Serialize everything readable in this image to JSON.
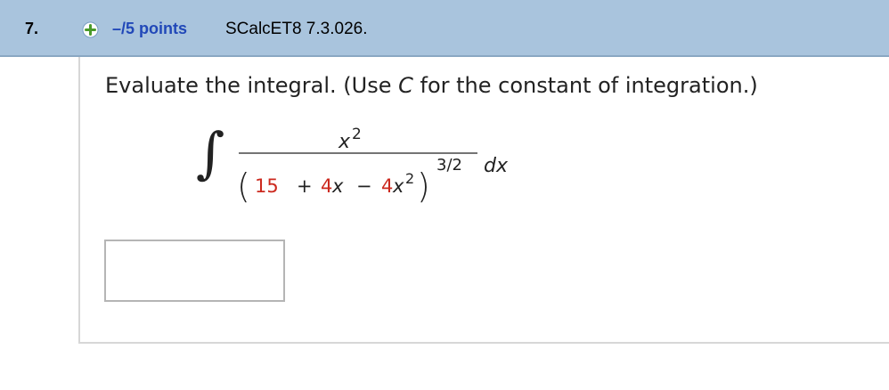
{
  "question": {
    "number": "7.",
    "points": "–/5 points",
    "source": "SCalcET8 7.3.026."
  },
  "instructions": {
    "before": "Evaluate the integral. (Use ",
    "variable": "C",
    "after": " for the constant of integration.)"
  },
  "integral": {
    "symbol": "∫",
    "numerator": "x",
    "numerator_exp": "2",
    "open_paren": "(",
    "close_paren": ")",
    "term1": "15",
    "op1": "+",
    "term2_coef": "4",
    "term2_var": "x",
    "op2": "−",
    "term3_coef": "4",
    "term3_var": "x",
    "term3_exp": "2",
    "outer_exp": "3/2",
    "differential": "dx"
  },
  "colors": {
    "header_bg": "#a9c4dd",
    "points": "#2148b8",
    "coefficient": "#cc2a1f",
    "plus_icon": "#4a9a2a"
  },
  "answer": {
    "value": ""
  }
}
